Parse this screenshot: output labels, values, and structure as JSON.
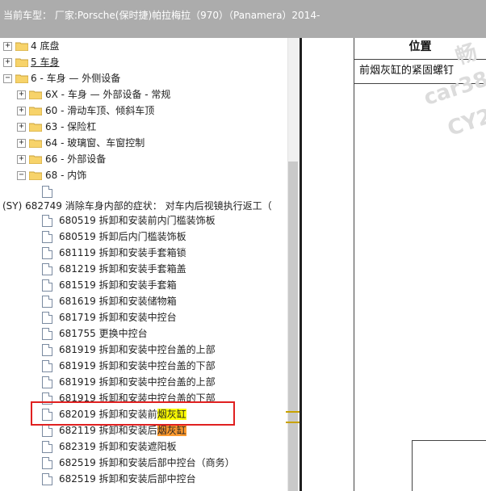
{
  "topbar": {
    "text": "当前车型： 厂家:Porsche(保时捷)帕拉梅拉（970）（Panamera）2014-"
  },
  "tree": {
    "n1": "4 底盘",
    "n2": "5 车身",
    "n3": "6 - 车身 — 外侧设备",
    "n4": "6X - 车身 — 外部设备 - 常规",
    "n5": "60 - 滑动车顶、倾斜车顶",
    "n6": "63 - 保险杠",
    "n7": "64 - 玻璃窗、车窗控制",
    "n8": "66 - 外部设备",
    "n9": "68 - 内饰",
    "sy": "(SY) 682749 消除车身内部的症状： 对车内后视镜执行返工（",
    "d1": "680519 拆卸和安装前内门槛装饰板",
    "d2": "680519 拆卸后内门槛装饰板",
    "d3": "681119 拆卸和安装手套箱锁",
    "d4": "681219 拆卸和安装手套箱盖",
    "d5": "681519 拆卸和安装手套箱",
    "d6": "681619 拆卸和安装储物箱",
    "d7": "681719 拆卸和安装中控台",
    "d8": "681755 更换中控台",
    "d9": "681919 拆卸和安装中控台盖的上部",
    "d10": "681919 拆卸和安装中控台盖的下部",
    "d11": "681919 拆卸和安装中控台盖的上部",
    "d12": "681919 拆卸和安装中控台盖的下部",
    "d13a": "682019 拆卸和安装前",
    "d13b": "烟灰缸",
    "d14a": "682119 拆卸和安装后",
    "d14b": "烟灰缸",
    "d15": "682319 拆卸和安装遮阳板",
    "d16": "682519 拆卸和安装后部中控台（商务）",
    "d17": "682519 拆卸和安装后部中控台"
  },
  "right": {
    "header": "位置",
    "cell": "前烟灰缸的紧固螺钉",
    "wm1": "畅",
    "wm2": "car38",
    "wm3": "CY2"
  },
  "colors": {
    "highlight_yellow": "#ffff00",
    "highlight_orange": "#ff9a2e",
    "selection_box": "#e02020",
    "topbar": "#acacac"
  }
}
